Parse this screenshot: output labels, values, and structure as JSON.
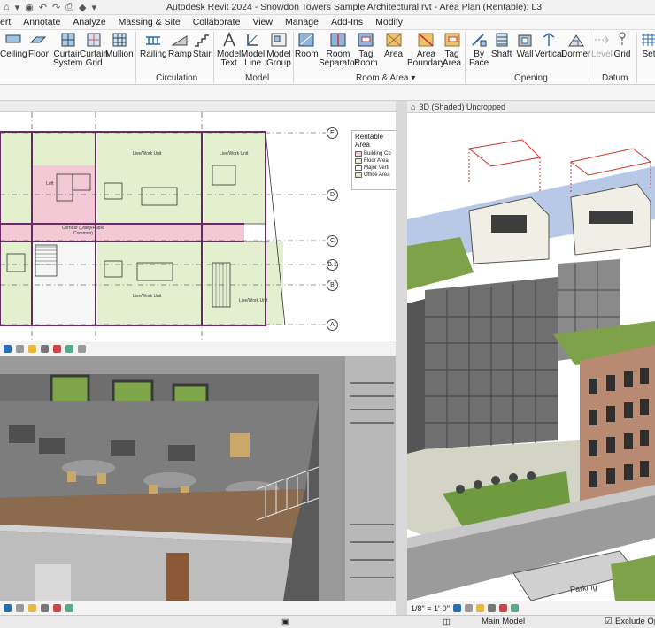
{
  "window": {
    "title": "Autodesk Revit 2024 - Snowdon Towers Sample Architectural.rvt - Area Plan (Rentable): L3"
  },
  "menu_tabs": [
    "ert",
    "Annotate",
    "Analyze",
    "Massing & Site",
    "Collaborate",
    "View",
    "Manage",
    "Add-Ins",
    "Modify"
  ],
  "ribbon": {
    "tools": {
      "ceiling": "Ceiling",
      "floor": "Floor",
      "curtain_system": [
        "Curtain",
        "System"
      ],
      "curtain_grid": [
        "Curtain",
        "Grid"
      ],
      "mullion": "Mullion",
      "railing": "Railing",
      "ramp": "Ramp",
      "stair": "Stair",
      "model_text": [
        "Model",
        "Text"
      ],
      "model_line": [
        "Model",
        "Line"
      ],
      "model_group": [
        "Model",
        "Group"
      ],
      "room": "Room",
      "room_separator": [
        "Room",
        "Separator"
      ],
      "tag_room": [
        "Tag",
        "Room"
      ],
      "area": "Area",
      "area_boundary": [
        "Area",
        "Boundary"
      ],
      "tag_area": [
        "Tag",
        "Area"
      ],
      "by_face": [
        "By",
        "Face"
      ],
      "shaft": "Shaft",
      "wall": "Wall",
      "vertical": "Vertical",
      "dormer": "Dormer",
      "level": "Level",
      "grid": "Grid",
      "set": "Set"
    },
    "panels": {
      "circulation": "Circulation",
      "model": "Model",
      "room_area": "Room & Area",
      "opening": "Opening",
      "datum": "Datum"
    }
  },
  "views": {
    "view3d_title": "3D (Shaded) Uncropped",
    "legend_title": "Rentable Area",
    "legend_items": [
      "Building Co",
      "Floor Area",
      "Major Verti",
      "Office Area"
    ],
    "grid_labels": [
      "E",
      "D",
      "C",
      "B.1",
      "B",
      "A"
    ],
    "room_labels": [
      "Loft",
      "Live/Work Unit",
      "Corridor (Utility/Public Common)",
      "Live/Work Unit",
      "Live/Work Unit",
      "Live/Work Unit"
    ],
    "sign_text": "Parking"
  },
  "statusbar": {
    "scale": "1/8\" = 1'-0\"",
    "model": "Main Model",
    "exclude": "Exclude Option"
  },
  "colors": {
    "accent": "#2b6cb0",
    "area_green": "#e3efcf",
    "area_pink": "#f3c9d6",
    "brick": "#b98a72"
  }
}
